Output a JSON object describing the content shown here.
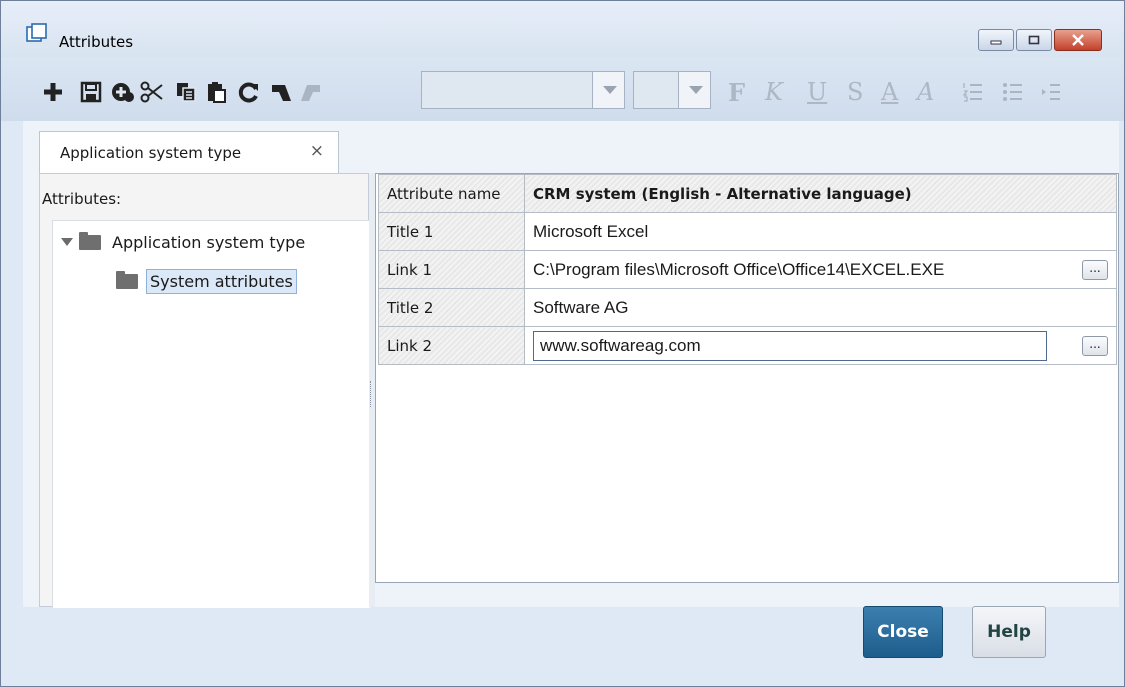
{
  "window": {
    "title": "Attributes",
    "icon": "window-icon",
    "controls": [
      "minimize-icon",
      "maximize-icon",
      "close-icon"
    ]
  },
  "toolbar": {
    "icons": [
      "new-icon",
      "save-icon",
      "add-icon",
      "cut-icon",
      "copy-icon",
      "paste-icon",
      "refresh-icon",
      "undo-icon",
      "redo-icon"
    ],
    "font_combo_value": "",
    "size_combo_value": "",
    "format": {
      "bold": "F",
      "italic": "K",
      "underline": "U",
      "strike": "S",
      "font_color": "A",
      "highlight": "A"
    }
  },
  "tab": {
    "label": "Application system type",
    "close": "×"
  },
  "left": {
    "label": "Attributes:",
    "tree": [
      {
        "label": "Application system type",
        "level": 0,
        "expanded": true
      },
      {
        "label": "System attributes",
        "level": 1,
        "selected": true
      }
    ]
  },
  "grid": {
    "header_name": "Attribute name",
    "header_value": "CRM system  (English - Alternative language)",
    "rows": [
      {
        "name": "Title 1",
        "value": "Microsoft Excel",
        "has_button": false,
        "editing": false
      },
      {
        "name": "Link 1",
        "value": "C:\\Program files\\Microsoft Office\\Office14\\EXCEL.EXE",
        "has_button": true,
        "editing": false
      },
      {
        "name": "Title 2",
        "value": "Software AG",
        "has_button": false,
        "editing": false
      },
      {
        "name": "Link 2",
        "value": "www.softwareag.com",
        "has_button": true,
        "editing": true
      }
    ],
    "button_label": "..."
  },
  "buttons": {
    "close": "Close",
    "help": "Help"
  },
  "colors": {
    "accent": "#1d5d8d",
    "close_button": "#c3412b",
    "selection": "#dbe8f8"
  }
}
